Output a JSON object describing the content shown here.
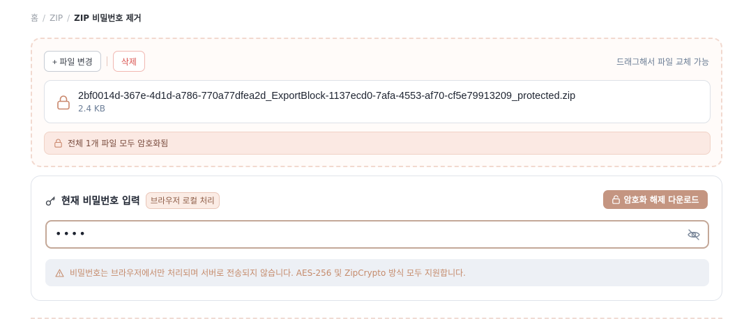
{
  "breadcrumb": {
    "home": "홈",
    "zip": "ZIP",
    "current": "ZIP 비밀번호 제거",
    "separator": "/"
  },
  "dropzone": {
    "change_button": "+ 파일 변경",
    "delete_button": "삭제",
    "drag_hint": "드래그해서 파일 교체 가능",
    "file": {
      "name": "2bf0014d-367e-4d1d-a786-770a77dfea2d_ExportBlock-1137ecd0-7afa-4553-af70-cf5e79913209_protected.zip",
      "size": "2.4 KB",
      "icon": "lock-icon"
    },
    "status": "전체 1개 파일 모두 암호화됨"
  },
  "password_panel": {
    "title": "현재 비밀번호 입력",
    "badge": "브라우저 로컬 처리",
    "decrypt_button": "암호화 해제 다운로드",
    "password_value": "••••",
    "notice": "비밀번호는 브라우저에서만 처리되며 서버로 전송되지 않습니다. AES-256 및 ZipCrypto 방식 모두 지원합니다."
  },
  "colors": {
    "accent": "#c49581",
    "delete": "#d9534f",
    "status_bg": "#fbe9e3",
    "notice_text": "#c58b6c"
  }
}
